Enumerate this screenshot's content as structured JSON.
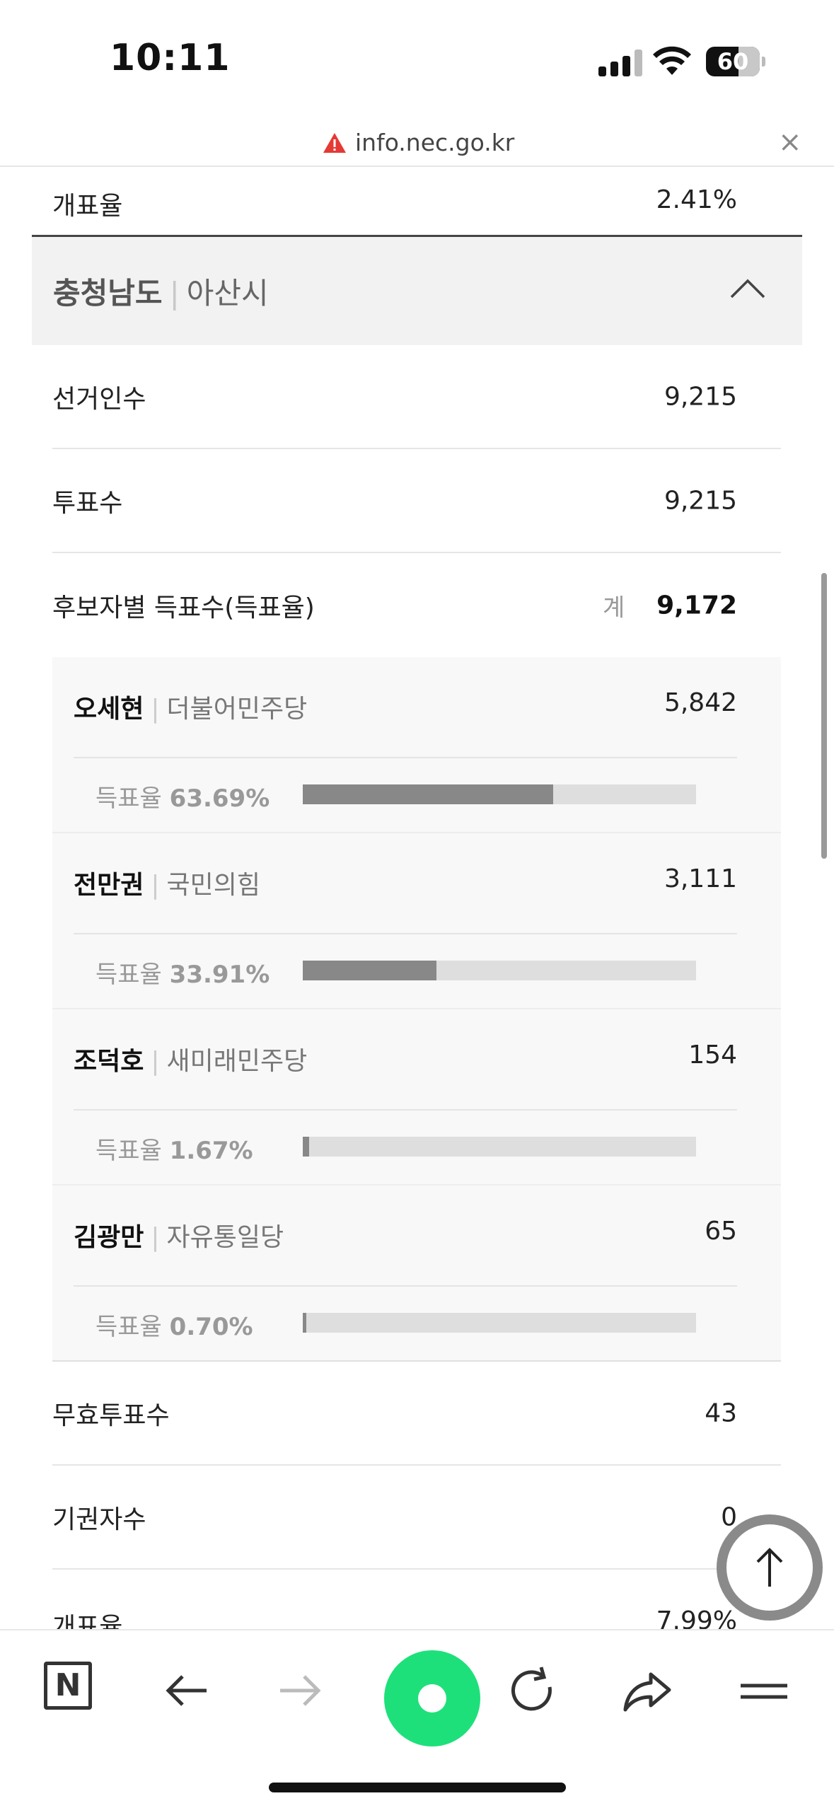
{
  "status_bar": {
    "time": "10:11",
    "battery": "60",
    "battery_level": 0.6
  },
  "url_bar": {
    "url": "info.nec.go.kr",
    "close_glyph": "×",
    "warning_icon": "warning-triangle-icon"
  },
  "top_row": {
    "label": "개표율",
    "value": "2.41%"
  },
  "region": {
    "province": "충청남도",
    "separator": "|",
    "city": "아산시",
    "expanded": true
  },
  "stats": {
    "electorate_label": "선거인수",
    "electorate_value": "9,215",
    "votes_label": "투표수",
    "votes_value": "9,215",
    "by_candidate_label": "후보자별 득표수(득표율)",
    "total_label": "계",
    "total_value": "9,172"
  },
  "candidates": [
    {
      "name": "오세현",
      "party": "더불어민주당",
      "votes": "5,842",
      "rate_label": "득표율",
      "rate": "63.69%",
      "rate_value": 63.69
    },
    {
      "name": "전만권",
      "party": "국민의힘",
      "votes": "3,111",
      "rate_label": "득표율",
      "rate": "33.91%",
      "rate_value": 33.91
    },
    {
      "name": "조덕호",
      "party": "새미래민주당",
      "votes": "154",
      "rate_label": "득표율",
      "rate": "1.67%",
      "rate_value": 1.67
    },
    {
      "name": "김광만",
      "party": "자유통일당",
      "votes": "65",
      "rate_label": "득표율",
      "rate": "0.70%",
      "rate_value": 0.7
    }
  ],
  "footer_rows": {
    "invalid_label": "무효투표수",
    "invalid_value": "43",
    "abstain_label": "기권자수",
    "abstain_value": "0",
    "count_rate_label": "개표율",
    "count_rate_value": "7.99%"
  },
  "toolbar": {
    "naver_label": "N",
    "icons": [
      "naver-home-icon",
      "back-arrow-icon",
      "forward-arrow-icon",
      "green-dot-icon",
      "reload-icon",
      "share-icon",
      "menu-icon"
    ]
  },
  "colors": {
    "bar_fill": "#888888",
    "bar_track": "#dedede",
    "warning": "#e53935",
    "green": "#1ee07a"
  }
}
